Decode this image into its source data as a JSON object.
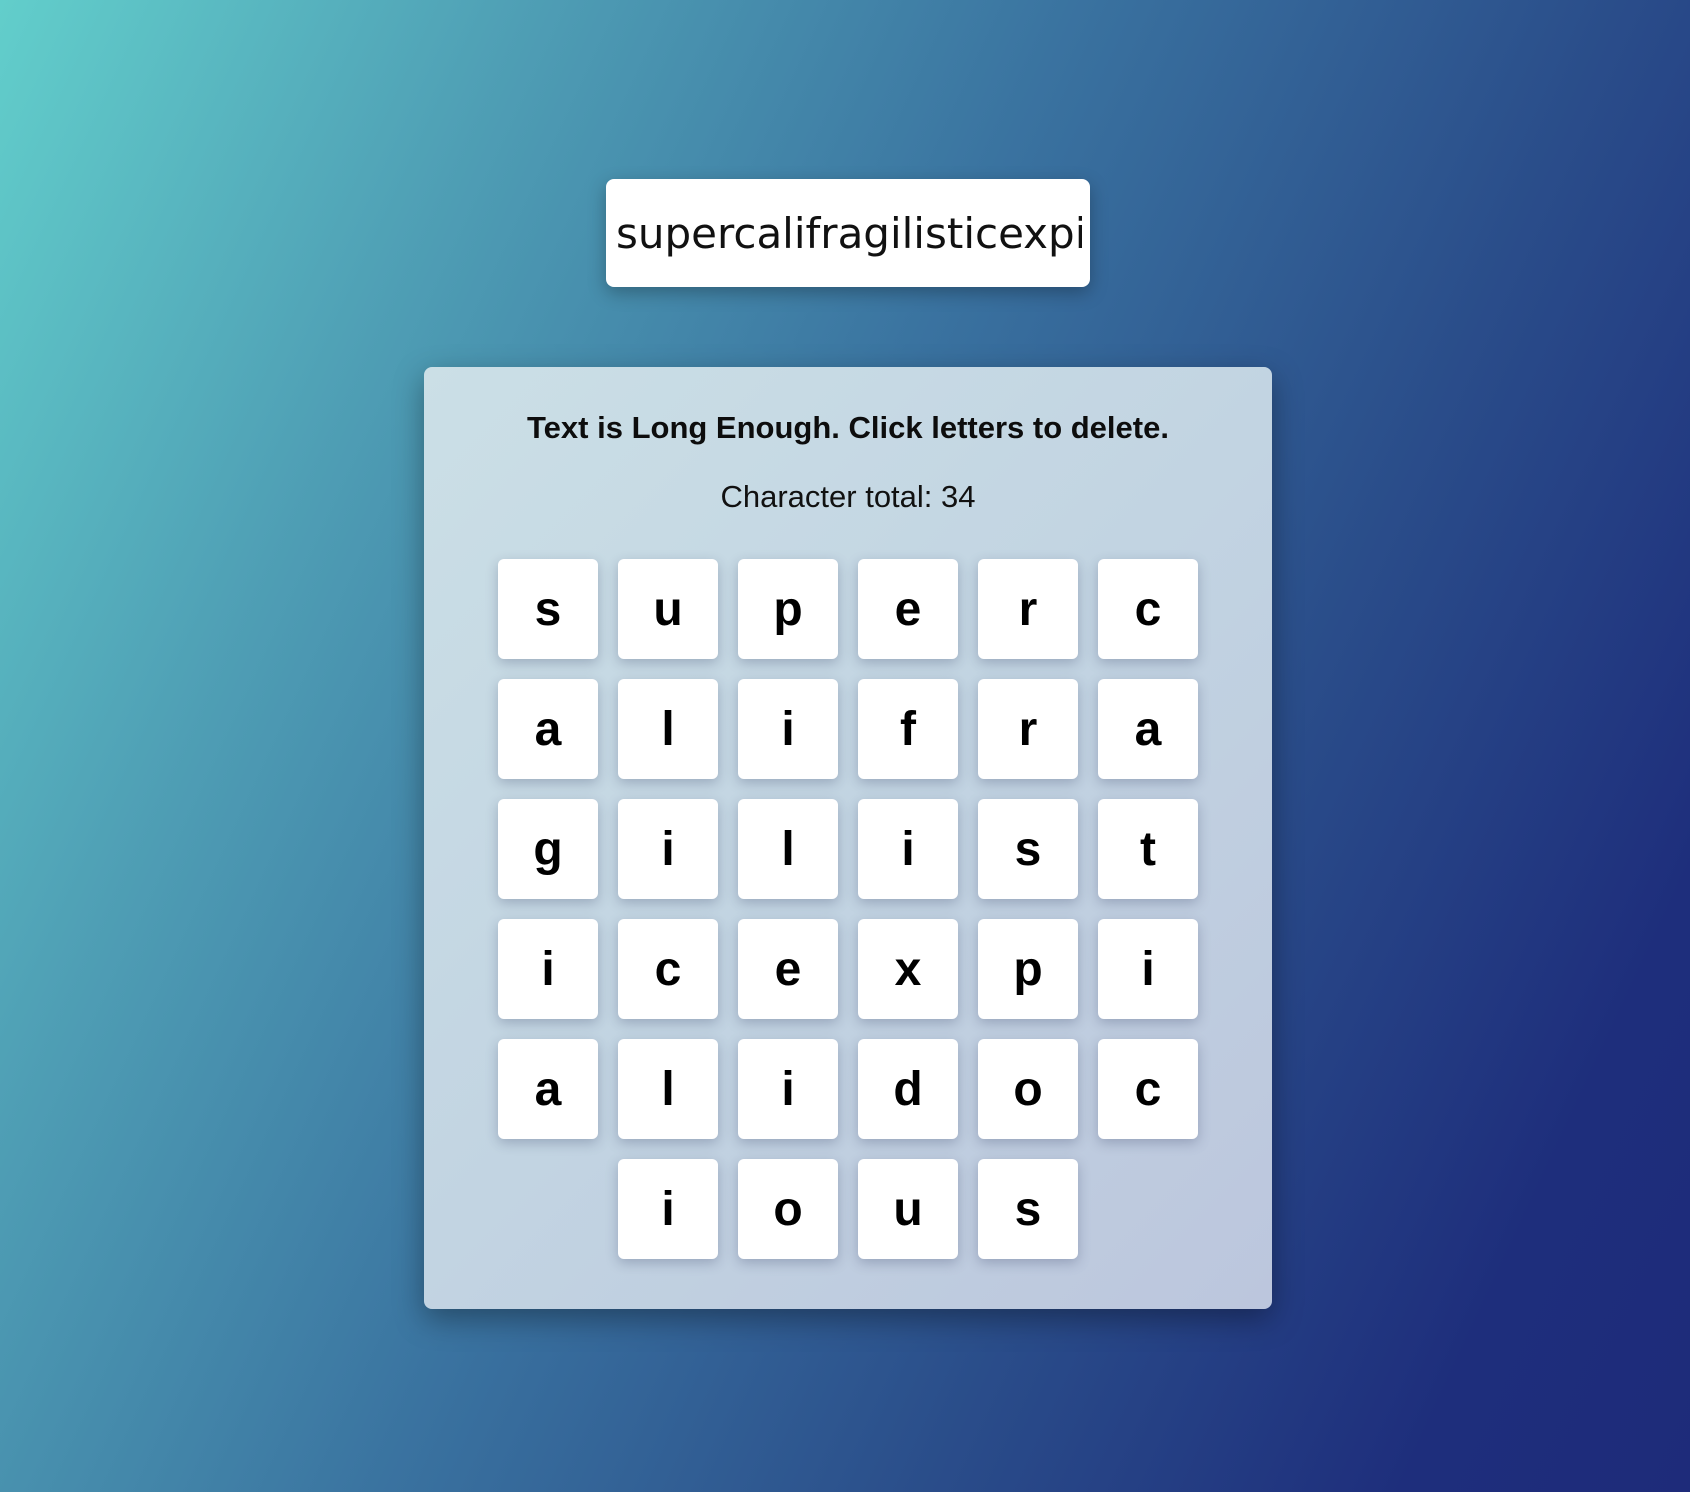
{
  "input": {
    "value": "supercalifragilisticexpialidocious"
  },
  "panel": {
    "heading": "Text is Long Enough. Click letters to delete.",
    "total_label": "Character total: 34"
  },
  "letters": [
    "s",
    "u",
    "p",
    "e",
    "r",
    "c",
    "a",
    "l",
    "i",
    "f",
    "r",
    "a",
    "g",
    "i",
    "l",
    "i",
    "s",
    "t",
    "i",
    "c",
    "e",
    "x",
    "p",
    "i",
    "a",
    "l",
    "i",
    "d",
    "o",
    "c",
    "i",
    "o",
    "u",
    "s"
  ]
}
